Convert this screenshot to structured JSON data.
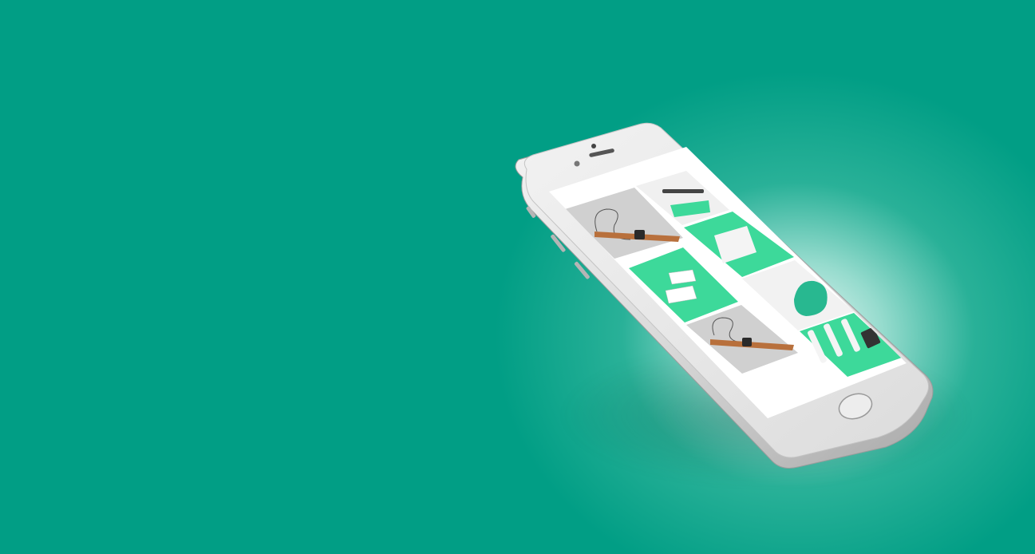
{
  "scene": {
    "background_color": "#019e85",
    "highlight_color": "#ffffff",
    "accent_color": "#3dd99a",
    "leather_color": "#b8703c"
  },
  "phone": {
    "device": "smartphone",
    "finish": "silver",
    "screen_content": "mockup-photo-grid",
    "tiles": [
      "watch-with-earphones",
      "watch-on-green-card",
      "green-paper-notebook",
      "business-cards",
      "green-chair",
      "watch-with-earphones",
      "green-cosmetic-tubes"
    ]
  }
}
